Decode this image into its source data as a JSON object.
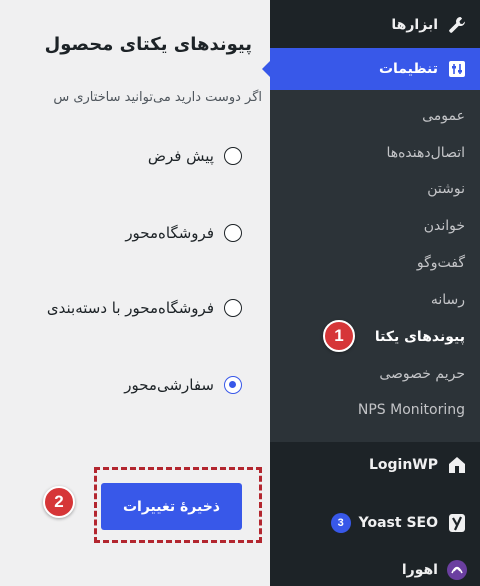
{
  "content": {
    "title": "پیوندهای یکتای محصول",
    "description": "اگر دوست دارید می‌توانید ساختاری س",
    "radio_options": [
      {
        "label": "پیش فرض",
        "checked": false
      },
      {
        "label": "فروشگاه‌محور",
        "checked": false
      },
      {
        "label": "فروشگاه‌محور با دسته‌بندی",
        "checked": false
      },
      {
        "label": "سفارشی‌محور",
        "checked": true
      }
    ],
    "save_button": "ذخیرهٔ تغییرات",
    "step_badge": "2"
  },
  "sidebar": {
    "tools": "ابزارها",
    "settings": "تنظیمات",
    "submenu": [
      "عمومی",
      "اتصال‌دهنده‌ها",
      "نوشتن",
      "خواندن",
      "گفت‌وگو",
      "رسانه",
      "پیوندهای یکتا",
      "حریم خصوصی",
      "NPS Monitoring"
    ],
    "current_index": 6,
    "step_badge": "1",
    "loginwp": "LoginWP",
    "yoast": "Yoast SEO",
    "yoast_count": "3",
    "ahura": "اهورا"
  },
  "colors": {
    "accent": "#3858e9",
    "sidebar_bg": "#1d2327",
    "submenu_bg": "#2c3338",
    "callout_red": "#d63638"
  }
}
